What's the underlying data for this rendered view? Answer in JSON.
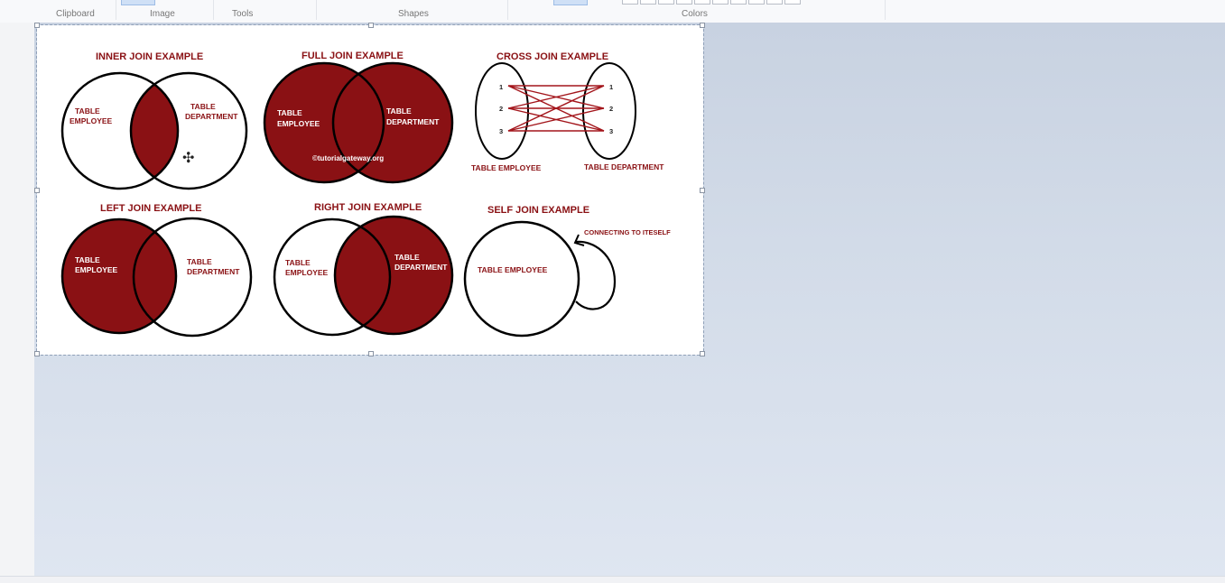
{
  "ribbon": {
    "groups": [
      "Clipboard",
      "Image",
      "Tools",
      "Shapes",
      "Colors"
    ]
  },
  "diagram": {
    "inner": {
      "title": "INNER JOIN EXAMPLE",
      "left": [
        "TABLE",
        "EMPLOYEE"
      ],
      "right": [
        "TABLE",
        "DEPARTMENT"
      ]
    },
    "full": {
      "title": "FULL JOIN EXAMPLE",
      "left": [
        "TABLE",
        "EMPLOYEE"
      ],
      "right": [
        "TABLE",
        "DEPARTMENT"
      ],
      "watermark": "©tutorialgateway.org"
    },
    "cross": {
      "title": "CROSS JOIN EXAMPLE",
      "left_label": "TABLE EMPLOYEE",
      "right_label": "TABLE DEPARTMENT",
      "nums": [
        "1",
        "2",
        "3"
      ]
    },
    "left": {
      "title": "LEFT JOIN EXAMPLE",
      "left": [
        "TABLE",
        "EMPLOYEE"
      ],
      "right": [
        "TABLE",
        "DEPARTMENT"
      ]
    },
    "right": {
      "title": "RIGHT JOIN EXAMPLE",
      "left": [
        "TABLE",
        "EMPLOYEE"
      ],
      "right": [
        "TABLE",
        "DEPARTMENT"
      ]
    },
    "self": {
      "title": "SELF JOIN EXAMPLE",
      "label": "TABLE EMPLOYEE",
      "note": "CONNECTING TO ITESELF"
    }
  },
  "colors": {
    "accent": "#8a1114",
    "canvas": "#ffffff",
    "workspace": "#d2dbe8"
  }
}
